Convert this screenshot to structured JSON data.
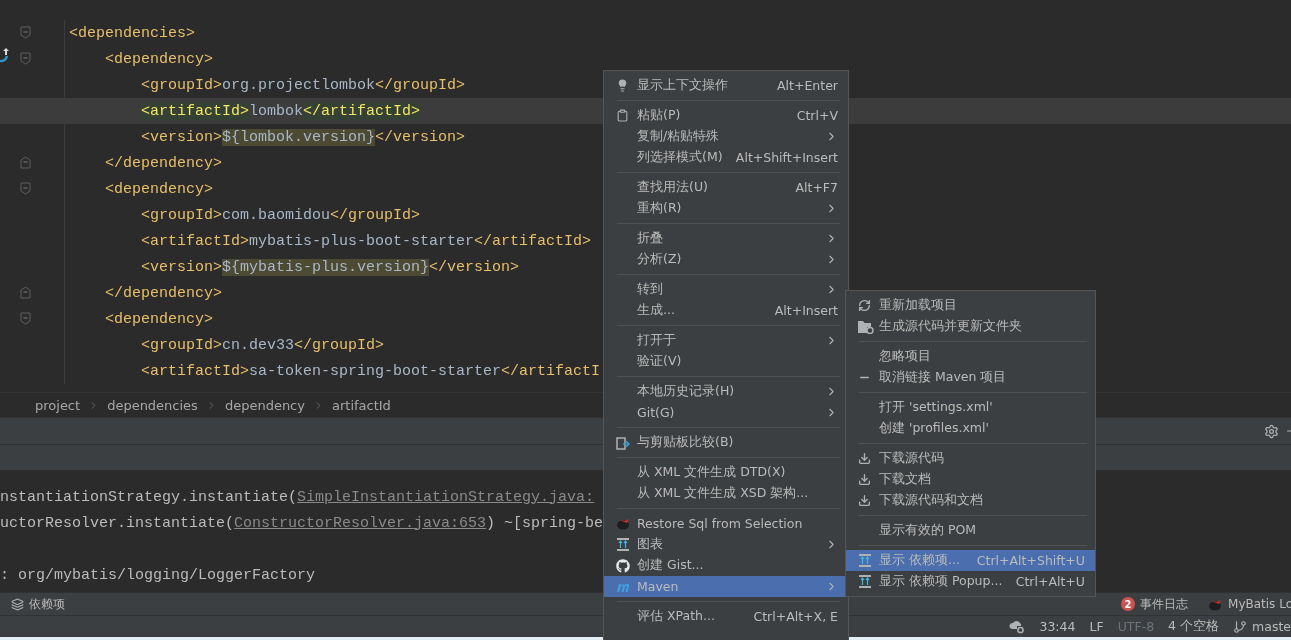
{
  "editor": {
    "lines": [
      {
        "kind": "element",
        "open": "<dependencies>",
        "gutter_marker": false,
        "children": [
          {
            "kind": "element",
            "open": "<dependency>",
            "gutter_marker": true,
            "children": [
              {
                "kind": "leaf",
                "open": "<groupId>",
                "value": "org.projectlombok",
                "close": "</groupId>",
                "matched": false,
                "marked": false,
                "current": false
              },
              {
                "kind": "leaf",
                "open": "<artifactId>",
                "value": "lombok",
                "close": "</artifactId>",
                "matched": true,
                "marked": false,
                "current": true
              },
              {
                "kind": "leaf",
                "open": "<version>",
                "value": "${lombok.version}",
                "close": "</version>",
                "matched": false,
                "marked": true,
                "current": false
              }
            ],
            "close": "</dependency>"
          },
          {
            "kind": "element",
            "open": "<dependency>",
            "gutter_marker": false,
            "children": [
              {
                "kind": "leaf",
                "open": "<groupId>",
                "value": "com.baomidou",
                "close": "</groupId>",
                "matched": false,
                "marked": false,
                "current": false
              },
              {
                "kind": "leaf",
                "open": "<artifactId>",
                "value": "mybatis-plus-boot-starter",
                "close": "</artifactId>",
                "matched": false,
                "marked": false,
                "current": false
              },
              {
                "kind": "leaf",
                "open": "<version>",
                "value": "${mybatis-plus.version}",
                "close": "</version>",
                "matched": false,
                "marked": true,
                "current": false
              }
            ],
            "close": "</dependency>"
          },
          {
            "kind": "element",
            "open": "<dependency>",
            "gutter_marker": false,
            "children": [
              {
                "kind": "leaf",
                "open": "<groupId>",
                "value": "cn.dev33",
                "close": "</groupId>",
                "matched": false,
                "marked": false,
                "current": false
              },
              {
                "kind": "leaf",
                "open": "<artifactId>",
                "value": "sa-token-spring-boot-starter",
                "close": "</artifactI",
                "matched": false,
                "marked": false,
                "current": false
              }
            ]
          }
        ]
      }
    ]
  },
  "breadcrumbs": [
    "project",
    "dependencies",
    "dependency",
    "artifactId"
  ],
  "console": {
    "lines": [
      {
        "blank_before": false,
        "segments": [
          {
            "kind": "plain",
            "text": "nstantiationStrategy.instantiate("
          },
          {
            "kind": "link",
            "text": "SimpleInstantiationStrategy.java:"
          }
        ]
      },
      {
        "blank_before": false,
        "segments": [
          {
            "kind": "plain",
            "text": "uctorResolver.instantiate("
          },
          {
            "kind": "link",
            "text": "ConstructorResolver.java:653"
          },
          {
            "kind": "plain",
            "text": ") ~[spring-be"
          }
        ]
      },
      {
        "blank_before": true,
        "segments": [
          {
            "kind": "plain",
            "text": ": org/mybatis/logging/LoggerFactory"
          }
        ]
      }
    ]
  },
  "tool_bar": {
    "left": {
      "label": "依赖项"
    },
    "event_log": {
      "count": "2",
      "label": "事件日志"
    },
    "plugin": {
      "label": "MyBatis Lo"
    }
  },
  "status_bar": [
    {
      "kind": "icon"
    },
    {
      "kind": "text",
      "text": "33:44",
      "disabled": false
    },
    {
      "kind": "text",
      "text": "LF",
      "disabled": false
    },
    {
      "kind": "text",
      "text": "UTF-8",
      "disabled": true
    },
    {
      "kind": "text",
      "text": "4 个空格",
      "disabled": false
    },
    {
      "kind": "branch",
      "text": "maste",
      "disabled": false
    }
  ],
  "context_menu": {
    "items": [
      {
        "kind": "bulb",
        "label": "显示上下文操作",
        "shortcut": "Alt+Enter",
        "submenu": false,
        "selected": false
      },
      {
        "kind": "separator"
      },
      {
        "kind": "clipboard",
        "label": "粘贴(P)",
        "shortcut": "Ctrl+V",
        "submenu": false,
        "selected": false
      },
      {
        "kind": "item",
        "label": "复制/粘贴特殊",
        "submenu": true,
        "selected": false
      },
      {
        "kind": "item",
        "label": "列选择模式(M)",
        "shortcut": "Alt+Shift+Insert",
        "submenu": false,
        "selected": false
      },
      {
        "kind": "separator"
      },
      {
        "kind": "item",
        "label": "查找用法(U)",
        "shortcut": "Alt+F7",
        "submenu": false,
        "selected": false
      },
      {
        "kind": "item",
        "label": "重构(R)",
        "submenu": true,
        "selected": false
      },
      {
        "kind": "separator"
      },
      {
        "kind": "item",
        "label": "折叠",
        "submenu": true,
        "selected": false
      },
      {
        "kind": "item",
        "label": "分析(Z)",
        "submenu": true,
        "selected": false
      },
      {
        "kind": "separator"
      },
      {
        "kind": "item",
        "label": "转到",
        "submenu": true,
        "selected": false
      },
      {
        "kind": "item",
        "label": "生成...",
        "shortcut": "Alt+Insert",
        "submenu": false,
        "selected": false
      },
      {
        "kind": "separator"
      },
      {
        "kind": "item",
        "label": "打开于",
        "submenu": true,
        "selected": false
      },
      {
        "kind": "item",
        "label": "验证(V)",
        "submenu": false,
        "selected": false
      },
      {
        "kind": "separator"
      },
      {
        "kind": "item",
        "label": "本地历史记录(H)",
        "submenu": true,
        "selected": false
      },
      {
        "kind": "item",
        "label": "Git(G)",
        "submenu": true,
        "selected": false
      },
      {
        "kind": "separator"
      },
      {
        "kind": "compare",
        "label": "与剪贴板比较(B)",
        "submenu": false,
        "selected": false
      },
      {
        "kind": "separator"
      },
      {
        "kind": "item",
        "label": "从 XML 文件生成 DTD(X)",
        "submenu": false,
        "selected": false
      },
      {
        "kind": "item",
        "label": "从 XML 文件生成 XSD 架构...",
        "submenu": false,
        "selected": false
      },
      {
        "kind": "separator"
      },
      {
        "kind": "bird",
        "label": "Restore Sql from Selection",
        "submenu": false,
        "selected": false
      },
      {
        "kind": "diagram",
        "label": "图表",
        "submenu": true,
        "selected": false
      },
      {
        "kind": "github",
        "label": "创建 Gist...",
        "submenu": false,
        "selected": false
      },
      {
        "kind": "maven",
        "label": "Maven",
        "submenu": true,
        "selected": true
      },
      {
        "kind": "separator"
      },
      {
        "kind": "item",
        "label": "评估 XPath...",
        "shortcut": "Ctrl+Alt+X, E",
        "submenu": false,
        "selected": false
      }
    ]
  },
  "submenu": {
    "items": [
      {
        "kind": "reload",
        "label": "重新加载项目",
        "submenu": false,
        "selected": false
      },
      {
        "kind": "folder",
        "label": "生成源代码并更新文件夹",
        "submenu": false,
        "selected": false
      },
      {
        "kind": "separator"
      },
      {
        "kind": "item",
        "label": "忽略项目",
        "submenu": false,
        "selected": false
      },
      {
        "kind": "minus",
        "label": "取消链接 Maven 项目",
        "submenu": false,
        "selected": false
      },
      {
        "kind": "separator"
      },
      {
        "kind": "item",
        "label": "打开 'settings.xml'",
        "submenu": false,
        "selected": false
      },
      {
        "kind": "item",
        "label": "创建 'profiles.xml'",
        "submenu": false,
        "selected": false
      },
      {
        "kind": "separator"
      },
      {
        "kind": "download",
        "label": "下载源代码",
        "submenu": false,
        "selected": false
      },
      {
        "kind": "download",
        "label": "下载文档",
        "submenu": false,
        "selected": false
      },
      {
        "kind": "download",
        "label": "下载源代码和文档",
        "submenu": false,
        "selected": false
      },
      {
        "kind": "separator"
      },
      {
        "kind": "item",
        "label": "显示有效的 POM",
        "submenu": false,
        "selected": false
      },
      {
        "kind": "separator"
      },
      {
        "kind": "diagram",
        "label": "显示 依赖项...",
        "shortcut": "Ctrl+Alt+Shift+U",
        "submenu": false,
        "selected": true
      },
      {
        "kind": "diagram",
        "label": "显示 依赖项 Popup...",
        "shortcut": "Ctrl+Alt+U",
        "submenu": false,
        "selected": false
      }
    ]
  }
}
